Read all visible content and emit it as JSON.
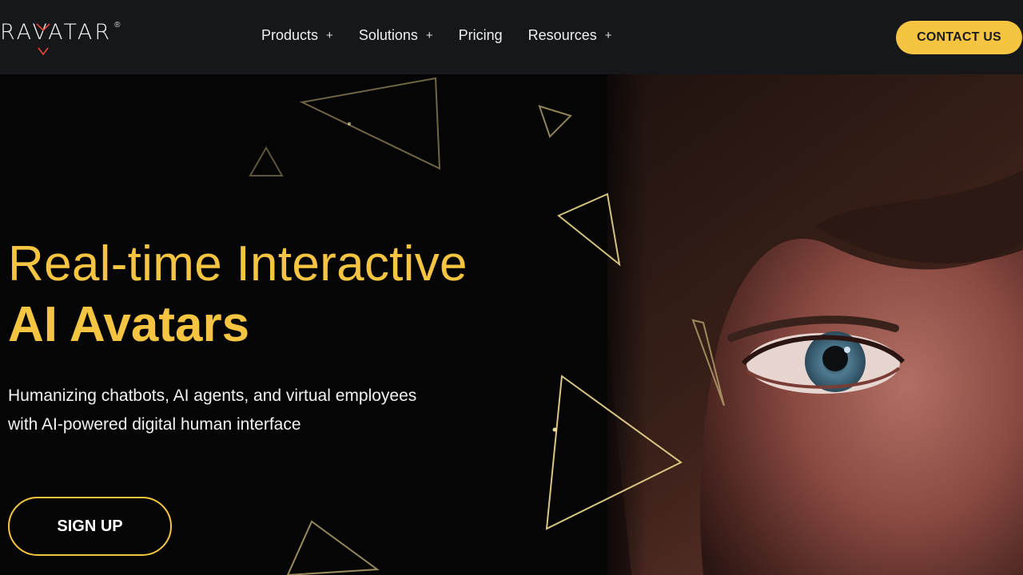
{
  "header": {
    "logo_text": "RAVATAR",
    "logo_registered": "®",
    "nav": [
      {
        "label": "Products",
        "has_submenu": true,
        "expand_symbol": "+"
      },
      {
        "label": "Solutions",
        "has_submenu": true,
        "expand_symbol": "+"
      },
      {
        "label": "Pricing",
        "has_submenu": false,
        "expand_symbol": ""
      },
      {
        "label": "Resources",
        "has_submenu": true,
        "expand_symbol": "+"
      }
    ],
    "contact_label": "CONTACT US"
  },
  "hero": {
    "headline_line1": "Real-time Interactive",
    "headline_line2": "AI Avatars",
    "subtext_line1": "Humanizing chatbots, AI agents, and virtual employees",
    "subtext_line2": "with AI-powered digital human interface",
    "signup_label": "SIGN UP",
    "image": "ai-avatar-face-closeup",
    "decorations": "gold-outline-triangles"
  },
  "colors": {
    "accent": "#f5c542",
    "navbar_bg": "#16171b",
    "page_bg": "#050505",
    "logo_mark": "#e8473c"
  }
}
